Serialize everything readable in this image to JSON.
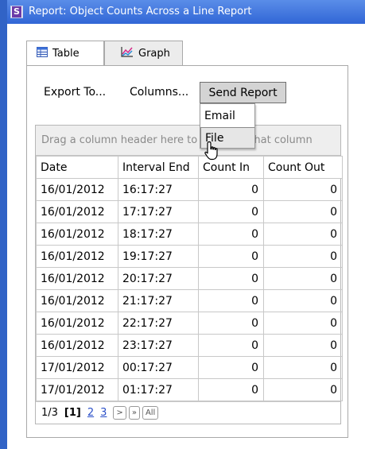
{
  "window": {
    "title": "Report: Object Counts Across a Line Report",
    "icon": "s-app-icon"
  },
  "tabs": [
    {
      "label": "Table",
      "icon": "table-icon",
      "active": true
    },
    {
      "label": "Graph",
      "icon": "graph-icon",
      "active": false
    }
  ],
  "toolbar": {
    "export_label": "Export To...",
    "columns_label": "Columns...",
    "send_label": "Send Report"
  },
  "send_menu": {
    "items": [
      "Email",
      "File"
    ],
    "hovered": "File"
  },
  "grid": {
    "group_hint": "Drag a column header here to group by that column",
    "columns": [
      "Date",
      "Interval End",
      "Count In",
      "Count Out"
    ],
    "rows": [
      [
        "16/01/2012",
        "16:17:27",
        "0",
        "0"
      ],
      [
        "16/01/2012",
        "17:17:27",
        "0",
        "0"
      ],
      [
        "16/01/2012",
        "18:17:27",
        "0",
        "0"
      ],
      [
        "16/01/2012",
        "19:17:27",
        "0",
        "0"
      ],
      [
        "16/01/2012",
        "20:17:27",
        "0",
        "0"
      ],
      [
        "16/01/2012",
        "21:17:27",
        "0",
        "0"
      ],
      [
        "16/01/2012",
        "22:17:27",
        "0",
        "0"
      ],
      [
        "16/01/2012",
        "23:17:27",
        "0",
        "0"
      ],
      [
        "17/01/2012",
        "00:17:27",
        "0",
        "0"
      ],
      [
        "17/01/2012",
        "01:17:27",
        "0",
        "0"
      ]
    ]
  },
  "pager": {
    "page_info": "1/3",
    "current": "[1]",
    "pages": [
      "2",
      "3"
    ],
    "next_label": ">",
    "last_label": "»",
    "all_label": "All"
  },
  "colors": {
    "titlebar": "#3166d6",
    "window_border": "#3163c6",
    "menu_hover": "#e6e6e6"
  }
}
